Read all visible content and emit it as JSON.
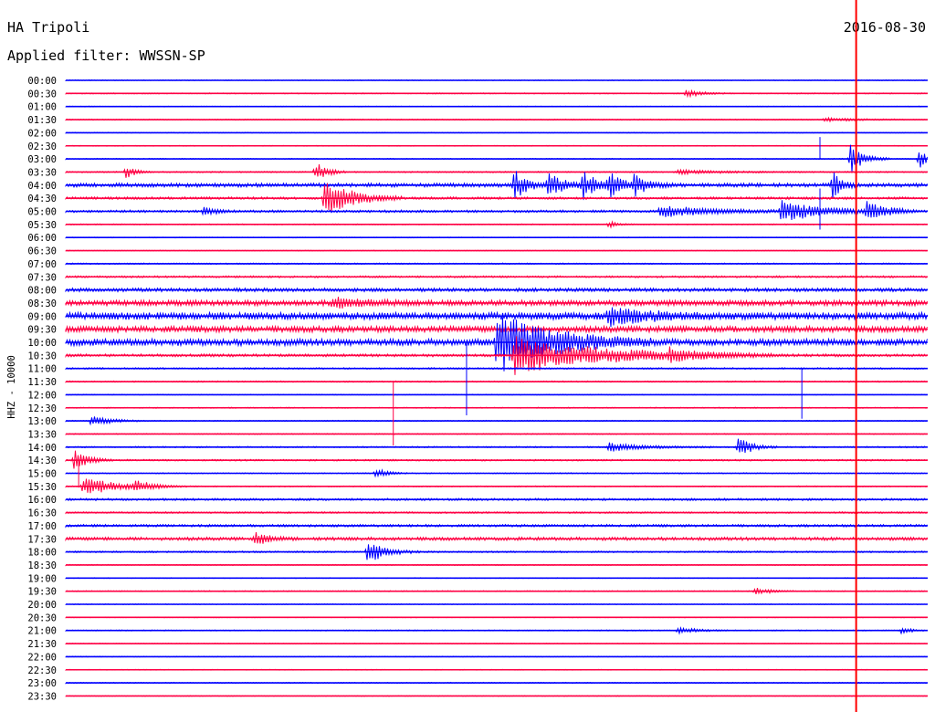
{
  "header": {
    "station": "HA Tripoli",
    "date": "2016-08-30",
    "filter": "Applied filter: WWSSN-SP"
  },
  "chart_data": {
    "type": "line",
    "ylabel": "HHZ - 10000",
    "colors": {
      "odd": "#0000ff",
      "even": "#ff0044",
      "marker": "#ff0000"
    },
    "rows": [
      "00:00",
      "00:30",
      "01:00",
      "01:30",
      "02:00",
      "02:30",
      "03:00",
      "03:30",
      "04:00",
      "04:30",
      "05:00",
      "05:30",
      "06:00",
      "06:30",
      "07:00",
      "07:30",
      "08:00",
      "08:30",
      "09:00",
      "09:30",
      "10:00",
      "10:30",
      "11:00",
      "11:30",
      "12:00",
      "12:30",
      "13:00",
      "13:30",
      "14:00",
      "14:30",
      "15:00",
      "15:30",
      "16:00",
      "16:30",
      "17:00",
      "17:30",
      "18:00",
      "18:30",
      "19:00",
      "19:30",
      "20:00",
      "20:30",
      "21:00",
      "21:30",
      "22:00",
      "22:30",
      "23:00",
      "23:30"
    ],
    "noise_level": [
      0.3,
      0.4,
      0.3,
      0.4,
      0.3,
      0.3,
      0.4,
      0.5,
      1.4,
      0.9,
      0.9,
      0.4,
      0.3,
      0.3,
      0.5,
      0.7,
      1.3,
      2.0,
      2.6,
      2.2,
      2.5,
      1.0,
      0.6,
      0.5,
      0.3,
      0.4,
      0.4,
      0.4,
      0.5,
      0.6,
      0.4,
      0.4,
      0.8,
      0.6,
      0.9,
      1.2,
      0.6,
      0.4,
      0.3,
      0.4,
      0.3,
      0.3,
      0.4,
      0.3,
      0.3,
      0.3,
      0.4,
      0.3
    ],
    "events": [
      {
        "row": 1,
        "pos": 0.72,
        "amp": 4,
        "dur": 0.015
      },
      {
        "row": 3,
        "pos": 0.88,
        "amp": 2,
        "dur": 0.03
      },
      {
        "row": 6,
        "pos": 0.91,
        "amp": 14,
        "dur": 0.015
      },
      {
        "row": 6,
        "pos": 0.99,
        "amp": 9,
        "dur": 0.01
      },
      {
        "row": 7,
        "pos": 0.07,
        "amp": 6,
        "dur": 0.01
      },
      {
        "row": 7,
        "pos": 0.29,
        "amp": 10,
        "dur": 0.012
      },
      {
        "row": 7,
        "pos": 0.71,
        "amp": 2,
        "dur": 0.05
      },
      {
        "row": 8,
        "pos": 0.52,
        "amp": 14,
        "dur": 0.015
      },
      {
        "row": 8,
        "pos": 0.56,
        "amp": 12,
        "dur": 0.015
      },
      {
        "row": 8,
        "pos": 0.6,
        "amp": 13,
        "dur": 0.015
      },
      {
        "row": 8,
        "pos": 0.63,
        "amp": 12,
        "dur": 0.015
      },
      {
        "row": 8,
        "pos": 0.66,
        "amp": 9,
        "dur": 0.015
      },
      {
        "row": 8,
        "pos": 0.89,
        "amp": 12,
        "dur": 0.01
      },
      {
        "row": 9,
        "pos": 0.3,
        "amp": 18,
        "dur": 0.03
      },
      {
        "row": 10,
        "pos": 0.16,
        "amp": 6,
        "dur": 0.01
      },
      {
        "row": 10,
        "pos": 0.69,
        "amp": 5,
        "dur": 0.06
      },
      {
        "row": 10,
        "pos": 0.83,
        "amp": 9,
        "dur": 0.05
      },
      {
        "row": 10,
        "pos": 0.93,
        "amp": 9,
        "dur": 0.02
      },
      {
        "row": 11,
        "pos": 0.63,
        "amp": 3,
        "dur": 0.01
      },
      {
        "row": 17,
        "pos": 0.31,
        "amp": 5,
        "dur": 0.03
      },
      {
        "row": 18,
        "pos": 0.63,
        "amp": 9,
        "dur": 0.04
      },
      {
        "row": 20,
        "pos": 0.5,
        "amp": 28,
        "dur": 0.06
      },
      {
        "row": 21,
        "pos": 0.52,
        "amp": 18,
        "dur": 0.1
      },
      {
        "row": 21,
        "pos": 0.7,
        "amp": 5,
        "dur": 0.03
      },
      {
        "row": 26,
        "pos": 0.03,
        "amp": 5,
        "dur": 0.02
      },
      {
        "row": 28,
        "pos": 0.63,
        "amp": 4,
        "dur": 0.04
      },
      {
        "row": 28,
        "pos": 0.78,
        "amp": 10,
        "dur": 0.015
      },
      {
        "row": 29,
        "pos": 0.01,
        "amp": 10,
        "dur": 0.015
      },
      {
        "row": 30,
        "pos": 0.36,
        "amp": 5,
        "dur": 0.012
      },
      {
        "row": 31,
        "pos": 0.02,
        "amp": 9,
        "dur": 0.04
      },
      {
        "row": 31,
        "pos": 0.08,
        "amp": 5,
        "dur": 0.015
      },
      {
        "row": 35,
        "pos": 0.22,
        "amp": 6,
        "dur": 0.015
      },
      {
        "row": 36,
        "pos": 0.35,
        "amp": 11,
        "dur": 0.02
      },
      {
        "row": 39,
        "pos": 0.8,
        "amp": 4,
        "dur": 0.015
      },
      {
        "row": 42,
        "pos": 0.71,
        "amp": 3,
        "dur": 0.02
      },
      {
        "row": 42,
        "pos": 0.97,
        "amp": 3,
        "dur": 0.01
      }
    ],
    "spikes": [
      {
        "row": 6,
        "pos": 0.875,
        "up": 24,
        "down": 0
      },
      {
        "row": 10,
        "pos": 0.875,
        "up": 25,
        "down": 20
      },
      {
        "row": 20,
        "pos": 0.465,
        "up": 0,
        "down": 80
      },
      {
        "row": 23,
        "pos": 0.38,
        "up": 0,
        "down": 70
      },
      {
        "row": 22,
        "pos": 0.854,
        "up": 0,
        "down": 55
      },
      {
        "row": 29,
        "pos": 0.015,
        "up": 0,
        "down": 30
      }
    ],
    "marker_line_pos": 0.917
  }
}
